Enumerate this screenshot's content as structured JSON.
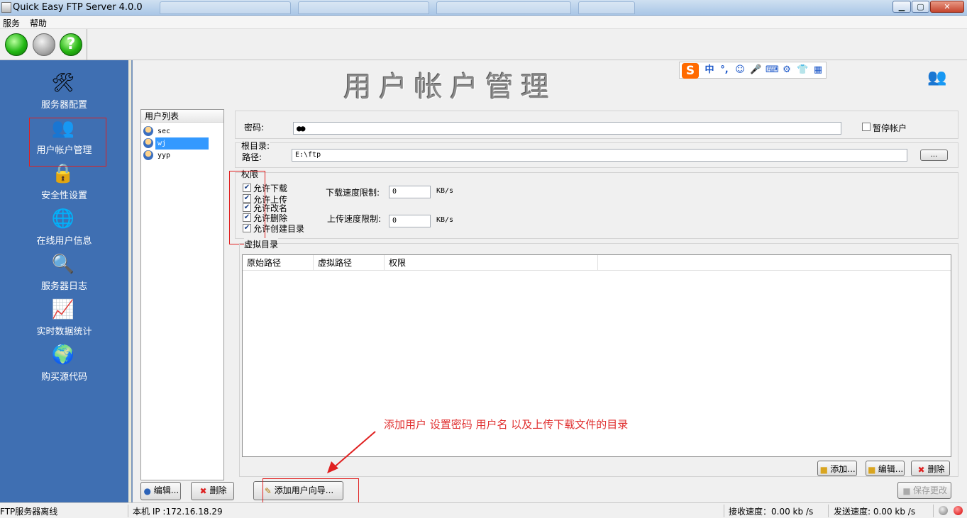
{
  "window": {
    "title": "Quick Easy FTP Server 4.0.0"
  },
  "menu": {
    "items": [
      "服务",
      "帮助"
    ]
  },
  "toolbar": {
    "help_symbol": "?"
  },
  "sidebar": {
    "items": [
      {
        "label": "服务器配置",
        "icon": "wrench-screwdriver-icon",
        "glyph": "🛠"
      },
      {
        "label": "用户帐户管理",
        "icon": "users-icon",
        "glyph": "👥"
      },
      {
        "label": "安全性设置",
        "icon": "lock-icon",
        "glyph": "🔒"
      },
      {
        "label": "在线用户信息",
        "icon": "globe-user-icon",
        "glyph": "🌐"
      },
      {
        "label": "服务器日志",
        "icon": "magnifier-log-icon",
        "glyph": "🔍"
      },
      {
        "label": "实时数据统计",
        "icon": "pulse-chart-icon",
        "glyph": "📈"
      },
      {
        "label": "购买源代码",
        "icon": "ie-globe-icon",
        "glyph": "🌍"
      }
    ]
  },
  "page": {
    "title": "用户帐户管理"
  },
  "ime": {
    "logo": "S",
    "lang": "中",
    "punct": "°,"
  },
  "userlist": {
    "header": "用户列表",
    "users": [
      "sec",
      "wj",
      "yyp"
    ],
    "selected": "wj",
    "edit_label": "编辑...",
    "delete_label": "删除"
  },
  "form": {
    "password_label": "密码:",
    "password_value": "●●",
    "suspend_label": "暂停帐户",
    "suspend_checked": false,
    "rootdir_label": "根目录:",
    "path_label": "路径:",
    "path_value": "E:\\ftp",
    "browse_label": "...",
    "perm_label": "权限",
    "permissions": [
      {
        "label": "允许下载",
        "checked": true
      },
      {
        "label": "允许上传",
        "checked": true
      },
      {
        "label": "允许改名",
        "checked": true
      },
      {
        "label": "允许删除",
        "checked": true
      },
      {
        "label": "允许创建目录",
        "checked": true
      }
    ],
    "download_limit_label": "下载速度限制:",
    "download_limit_value": "0",
    "upload_limit_label": "上传速度限制:",
    "upload_limit_value": "0",
    "unit": "KB/s"
  },
  "virtual_dirs": {
    "label": "虚拟目录",
    "columns": [
      "原始路径",
      "虚拟路径",
      "权限"
    ],
    "rows": [],
    "add_label": "添加...",
    "edit_label": "编辑...",
    "delete_label": "删除"
  },
  "wizard_label": "添加用户向导...",
  "save_label": "保存更改",
  "annotation": "添加用户  设置密码  用户名  以及上传下载文件的目录",
  "status": {
    "server_state": "FTP服务器离线",
    "local_ip": "本机 IP :172.16.18.29",
    "recv_label": "接收速度：0.00   kb /s",
    "send_label": "发送速度:  0.00   kb /s"
  },
  "colors": {
    "sidebar_bg": "#3f6fb2",
    "selection": "#3399ff",
    "annotation_red": "#e02020"
  }
}
